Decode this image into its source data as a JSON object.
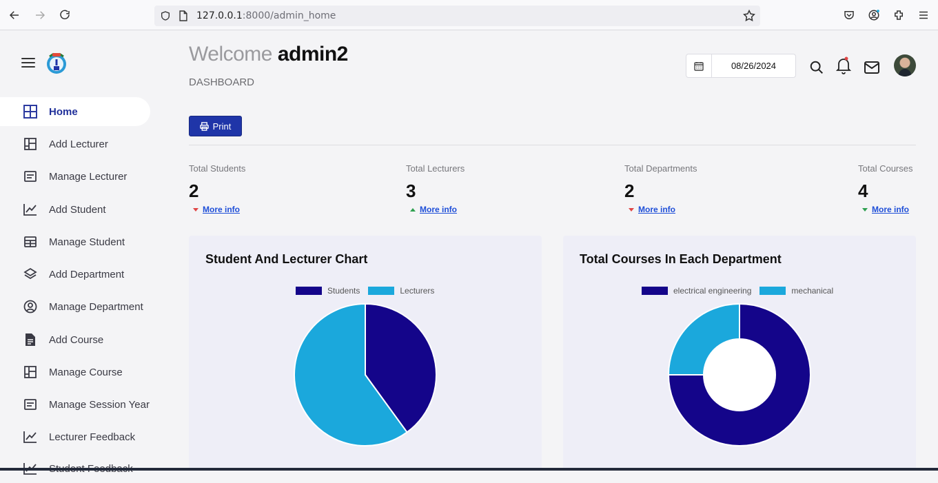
{
  "browser": {
    "url_host": "127.0.0.1",
    "url_rest": ":8000/admin_home"
  },
  "sidebar": {
    "items": [
      {
        "label": "Home",
        "icon": "grid-icon",
        "active": true
      },
      {
        "label": "Add Lecturer",
        "icon": "layout-icon"
      },
      {
        "label": "Manage Lecturer",
        "icon": "list-icon"
      },
      {
        "label": "Add Student",
        "icon": "chart-line-icon"
      },
      {
        "label": "Manage Student",
        "icon": "table-icon"
      },
      {
        "label": "Add Department",
        "icon": "layers-icon"
      },
      {
        "label": "Manage Department",
        "icon": "user-circle-icon"
      },
      {
        "label": "Add Course",
        "icon": "file-icon"
      },
      {
        "label": "Manage Course",
        "icon": "layout-icon"
      },
      {
        "label": "Manage Session Year",
        "icon": "list-icon"
      },
      {
        "label": "Lecturer Feedback",
        "icon": "chart-line-icon"
      },
      {
        "label": "Student Feedback",
        "icon": "chart-line-icon"
      }
    ]
  },
  "header": {
    "welcome": "Welcome",
    "username": "admin2",
    "subtitle": "DASHBOARD",
    "date": "08/26/2024"
  },
  "toolbar": {
    "print_label": "Print"
  },
  "stats": [
    {
      "label": "Total Students",
      "value": "2",
      "link": "More info",
      "trend": "down"
    },
    {
      "label": "Total Lecturers",
      "value": "3",
      "link": "More info",
      "trend": "up"
    },
    {
      "label": "Total Departments",
      "value": "2",
      "link": "More info",
      "trend": "down"
    },
    {
      "label": "Total Courses",
      "value": "4",
      "link": "More info",
      "trend": "down-green"
    }
  ],
  "colors": {
    "accent": "#1f35a8",
    "series1": "#14058a",
    "series2": "#1ba8dc"
  },
  "cards": {
    "left_title": "Student And Lecturer Chart",
    "right_title": "Total Courses In Each Department"
  },
  "chart_data": [
    {
      "type": "pie",
      "title": "Student And Lecturer Chart",
      "categories": [
        "Students",
        "Lecturers"
      ],
      "values": [
        2,
        3
      ],
      "colors": [
        "#14058a",
        "#1ba8dc"
      ],
      "legend": "top"
    },
    {
      "type": "pie",
      "title": "Total Courses In Each Department",
      "categories": [
        "electrical engineering",
        "mechanical"
      ],
      "values": [
        3,
        1
      ],
      "colors": [
        "#14058a",
        "#1ba8dc"
      ],
      "legend": "top",
      "doughnut": true
    }
  ]
}
